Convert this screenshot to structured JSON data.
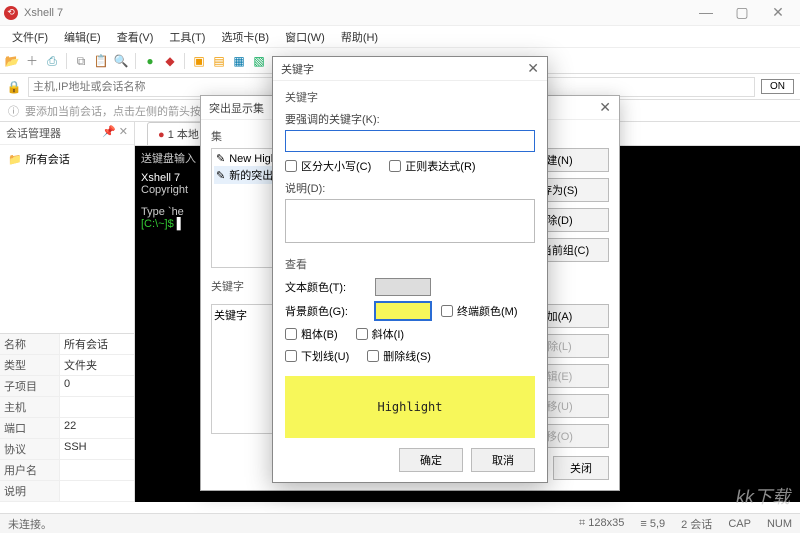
{
  "window": {
    "title": "Xshell 7"
  },
  "menu": [
    "文件(F)",
    "编辑(E)",
    "查看(V)",
    "工具(T)",
    "选项卡(B)",
    "窗口(W)",
    "帮助(H)"
  ],
  "toolbar_icons": [
    "folder",
    "new",
    "save",
    "sep",
    "copy",
    "paste",
    "search",
    "sep",
    "text",
    "color",
    "sep",
    "misc1",
    "misc2",
    "misc3",
    "misc4"
  ],
  "addressbar": {
    "placeholder": "主机,IP地址或会话名称",
    "on": "ON"
  },
  "hint": {
    "icon": "ⓘ",
    "text": "要添加当前会话，点击左侧的箭头按钮。"
  },
  "sidebar": {
    "title": "会话管理器",
    "root": "所有会话",
    "props": [
      {
        "k": "名称",
        "v": "所有会话"
      },
      {
        "k": "类型",
        "v": "文件夹"
      },
      {
        "k": "子项目",
        "v": "0"
      },
      {
        "k": "主机",
        "v": ""
      },
      {
        "k": "端口",
        "v": "22"
      },
      {
        "k": "协议",
        "v": "SSH"
      },
      {
        "k": "用户名",
        "v": ""
      },
      {
        "k": "说明",
        "v": ""
      }
    ]
  },
  "tab": {
    "label": "1 本地"
  },
  "terminal": {
    "kbdprefix": "送键盘输入",
    "line1a": "Xshell 7",
    "line2": "Copyright",
    "line3": "Type `he",
    "prompt": "[C:\\~]$"
  },
  "hs_dialog": {
    "title": "突出显示集",
    "sets_label": "集",
    "sets": [
      "New Highli",
      "新的突出显"
    ],
    "btns": {
      "new": "新建(N)",
      "saveas": "另存为(S)",
      "del": "删除(D)",
      "cur": "置为当前组(C)",
      "add": "添加(A)",
      "del2": "删除(L)",
      "edit": "编辑(E)",
      "up": "上移(U)",
      "down": "下移(O)",
      "close": "关闭"
    },
    "kw_label": "关键字",
    "kw_items": [
      "关键字"
    ]
  },
  "kw_dialog": {
    "title": "关键字",
    "group": "关键字",
    "emph_label": "要强调的关键字(K):",
    "case": "区分大小写(C)",
    "regex": "正则表达式(R)",
    "desc_label": "说明(D):",
    "view_label": "查看",
    "textcolor": "文本颜色(T):",
    "bgcolor": "背景颜色(G):",
    "termcolor": "终端颜色(M)",
    "bold": "粗体(B)",
    "italic": "斜体(I)",
    "underline": "下划线(U)",
    "strike": "删除线(S)",
    "preview": "Highlight",
    "ok": "确定",
    "cancel": "取消"
  },
  "status": {
    "left": "未连接。",
    "size": "128x35",
    "pos": "5,9",
    "sess": "2 会话",
    "caps": "CAP",
    "num": "NUM"
  },
  "watermark": "kk下载"
}
